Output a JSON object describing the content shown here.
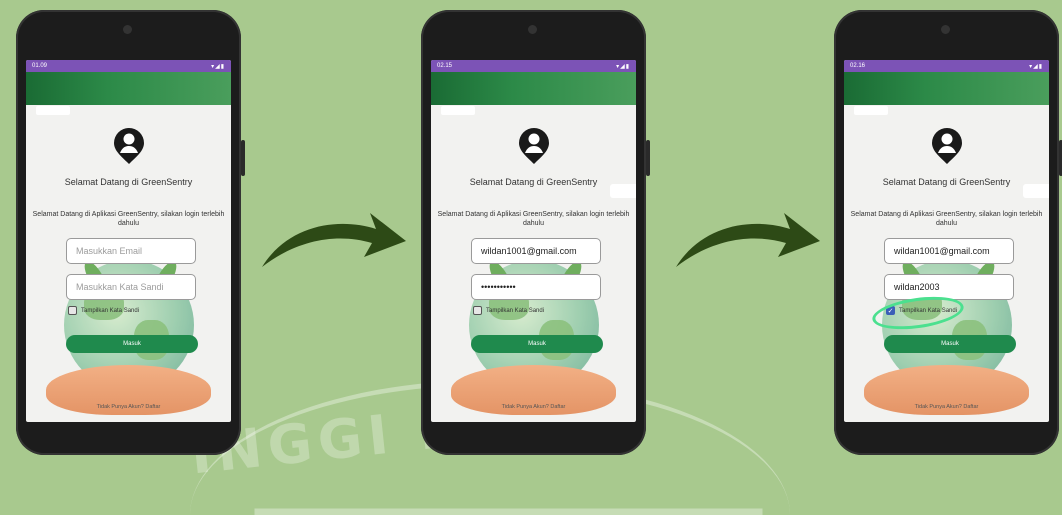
{
  "screens": [
    {
      "status_time": "01.09",
      "status_icons": "▾◢▮",
      "welcome": "Selamat Datang di GreenSentry",
      "subtitle": "Selamat Datang di Aplikasi GreenSentry, silakan login terlebih dahulu",
      "email_value": "",
      "email_placeholder": "Masukkan Email",
      "password_value": "",
      "password_placeholder": "Masukkan Kata Sandi",
      "show_password_label": "Tampilkan Kata Sandi",
      "show_password_checked": false,
      "login_button": "Masuk",
      "register_prompt": "Tidak Punya Akun? Daftar"
    },
    {
      "status_time": "02.15",
      "status_icons": "▾◢▮",
      "welcome": "Selamat Datang di GreenSentry",
      "subtitle": "Selamat Datang di Aplikasi GreenSentry, silakan login terlebih dahulu",
      "email_value": "wildan1001@gmail.com",
      "email_placeholder": "Masukkan Email",
      "password_value": "•••••••••••",
      "password_placeholder": "Masukkan Kata Sandi",
      "show_password_label": "Tampilkan Kata Sandi",
      "show_password_checked": false,
      "login_button": "Masuk",
      "register_prompt": "Tidak Punya Akun? Daftar"
    },
    {
      "status_time": "02.16",
      "status_icons": "▾◢▮",
      "welcome": "Selamat Datang di GreenSentry",
      "subtitle": "Selamat Datang di Aplikasi GreenSentry, silakan login terlebih dahulu",
      "email_value": "wildan1001@gmail.com",
      "email_placeholder": "Masukkan Email",
      "password_value": "wildan2003",
      "password_placeholder": "Masukkan Kata Sandi",
      "show_password_label": "Tampilkan Kata Sandi",
      "show_password_checked": true,
      "login_button": "Masuk",
      "register_prompt": "Tidak Punya Akun? Daftar"
    }
  ],
  "watermark": "INGGI ILM",
  "colors": {
    "background": "#a8c98e",
    "status_bar": "#7c53b6",
    "app_bar": "#1a6b34",
    "button": "#1f8a4d",
    "arrow": "#2d4a16",
    "highlight": "#4be08f"
  }
}
